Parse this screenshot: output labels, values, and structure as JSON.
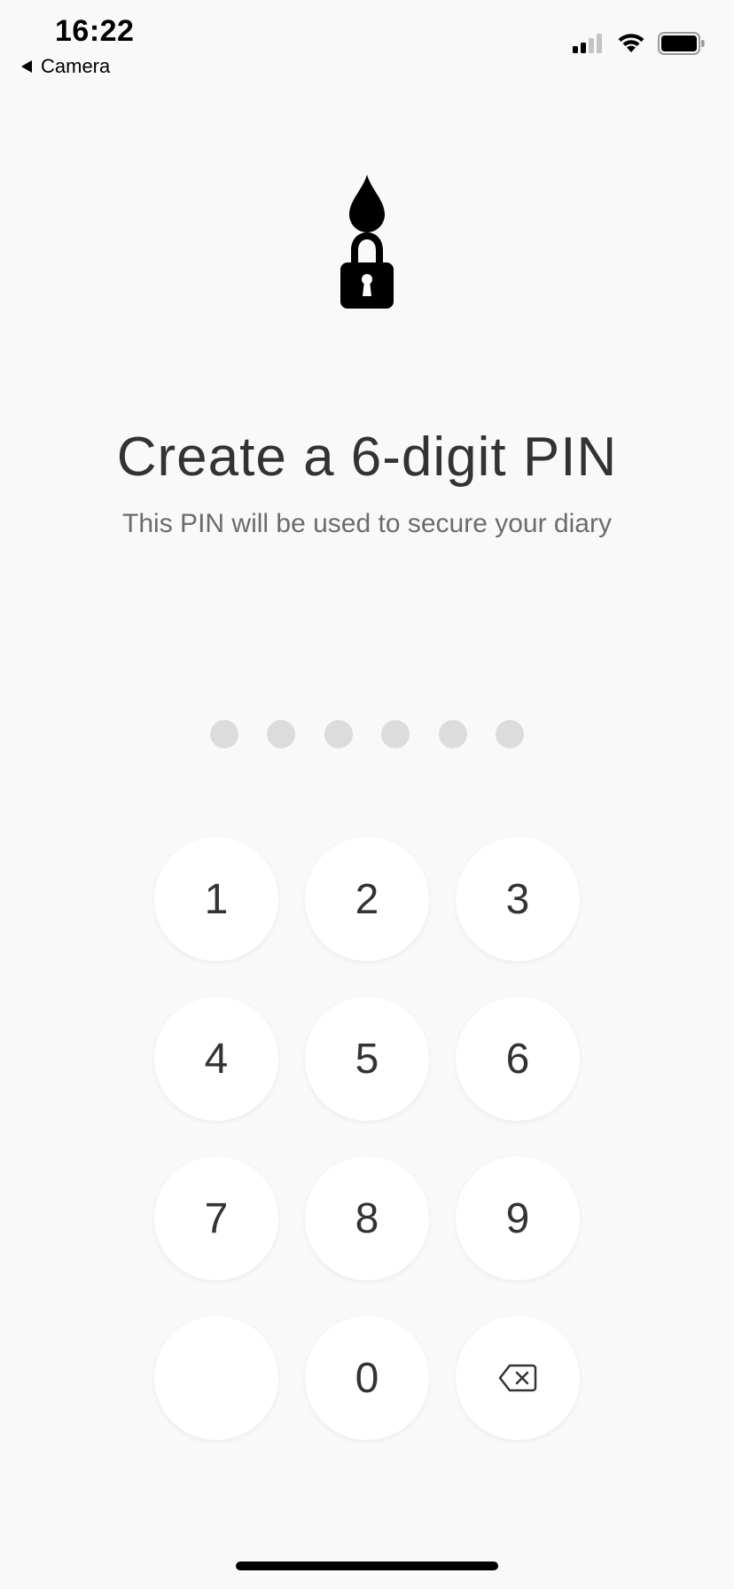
{
  "status_bar": {
    "time": "16:22",
    "back_label": "Camera",
    "icons": [
      "signal-icon",
      "wifi-icon",
      "battery-icon"
    ]
  },
  "header": {
    "logo_icon": "ink-drop-lock-icon",
    "title": "Create a 6-digit PIN",
    "subtitle": "This PIN will be used to secure your diary"
  },
  "pin": {
    "length": 6,
    "entered": 0
  },
  "keypad": {
    "keys": [
      "1",
      "2",
      "3",
      "4",
      "5",
      "6",
      "7",
      "8",
      "9",
      "",
      "0"
    ],
    "delete_icon": "backspace-icon"
  },
  "colors": {
    "background": "#f9f9f9",
    "key_background": "#ffffff",
    "text": "#333333",
    "dot_empty": "#dcdcdc"
  }
}
